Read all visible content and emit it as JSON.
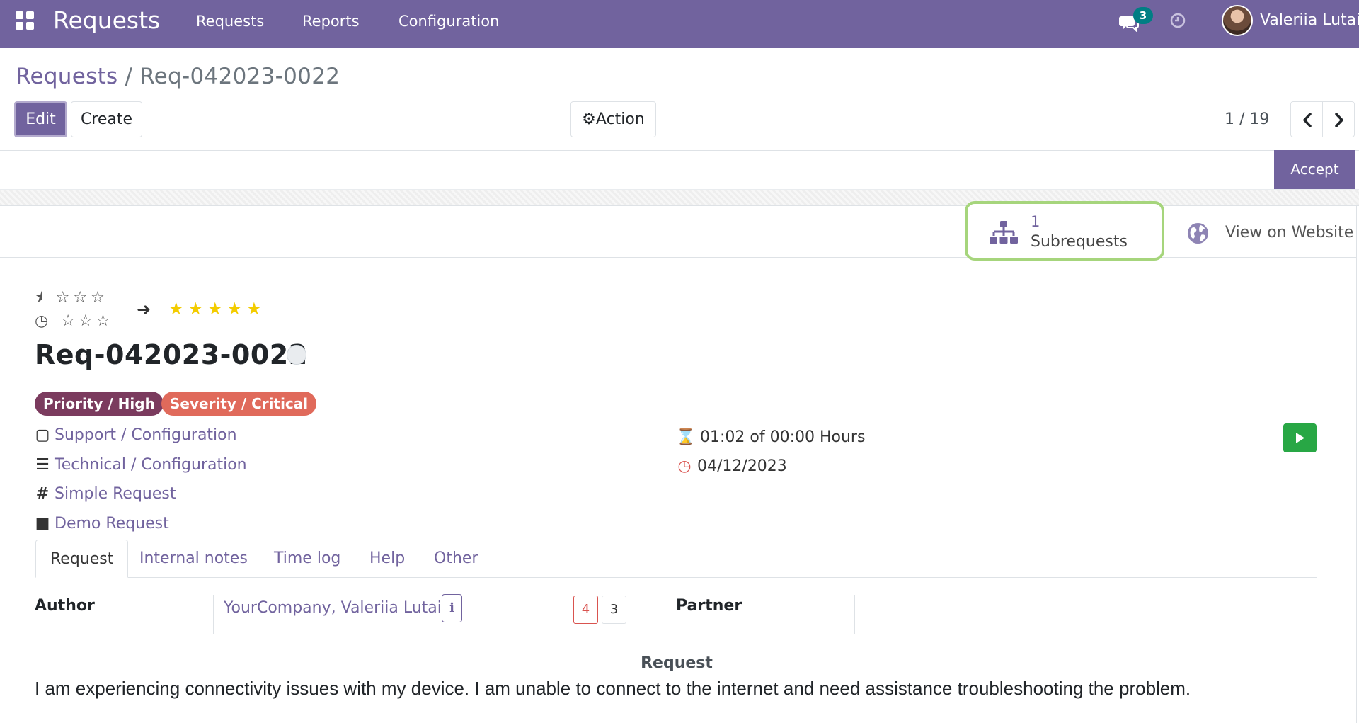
{
  "navbar": {
    "app_name": "Requests",
    "menus": [
      "Requests",
      "Reports",
      "Configuration"
    ],
    "chat_count": "3",
    "user_name": "Valeriia Lutai"
  },
  "breadcrumb": {
    "root": "Requests",
    "separator": "/",
    "current": "Req-042023-0022"
  },
  "buttons": {
    "edit": "Edit",
    "create": "Create",
    "action": "Action",
    "accept": "Accept"
  },
  "pager": {
    "value": "1 / 19"
  },
  "button_box": {
    "subrequests_count": "1",
    "subrequests_label": "Subrequests",
    "view_website_label": "View on Website"
  },
  "record": {
    "title": "Req-042023-0022",
    "tags": {
      "priority": "Priority / High",
      "severity": "Severity / Critical"
    },
    "service": "Support / Configuration",
    "category": "Technical / Configuration",
    "type": "Simple Request",
    "kind": "Demo Request",
    "timer": "01:02 of 00:00 Hours",
    "deadline": "04/12/2023"
  },
  "tabs": [
    "Request",
    "Internal notes",
    "Time log",
    "Help",
    "Other"
  ],
  "fields": {
    "author_label": "Author",
    "author_value": "YourCompany, Valeriia Lutai",
    "author_info": "i",
    "author_count_red": "4",
    "author_count": "3",
    "partner_label": "Partner"
  },
  "request": {
    "section_title": "Request",
    "text": "I am experiencing connectivity issues with my device. I am unable to connect to the internet and need assistance troubleshooting the problem."
  },
  "colors": {
    "brand": "#71639e",
    "priority_tag": "#7b3b5e",
    "severity_tag": "#e06a5b",
    "play": "#28a745",
    "highlight": "#a6d57c",
    "badge": "#017e84"
  }
}
